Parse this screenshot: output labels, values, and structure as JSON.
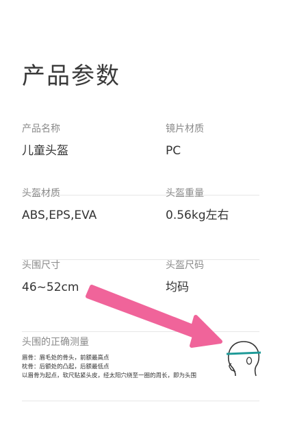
{
  "page": {
    "title": "产品参数"
  },
  "params": [
    {
      "left": {
        "label": "产品名称",
        "value": "儿童头盔"
      },
      "right": {
        "label": "镜片材质",
        "value": "PC"
      }
    },
    {
      "left": {
        "label": "头盔材质",
        "value": "ABS,EPS,EVA"
      },
      "right": {
        "label": "头盔重量",
        "value": "0.56kg左右"
      }
    },
    {
      "left": {
        "label": "头围尺寸",
        "value": "46~52cm"
      },
      "right": {
        "label": "头盔尺码",
        "value": "均码"
      }
    }
  ],
  "measure": {
    "title": "头围的正确测量",
    "notes": [
      "眉骨：眉毛处的骨头，前额最高点",
      "枕骨：后额处的凸起，后额最低点",
      "以眉骨为起点，软尺贴紧头皮，经太阳穴绕至一圈的周长，即为头围"
    ]
  },
  "icons": {
    "head": "head-measure-icon",
    "arrow": "pointer-arrow"
  },
  "colors": {
    "arrow": "#f0649a",
    "tape": "#1f9a98",
    "divider": "#e6e6e6"
  }
}
